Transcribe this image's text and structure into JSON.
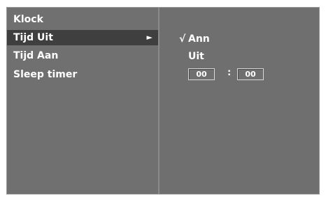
{
  "menu": {
    "items": [
      {
        "label": "Klock"
      },
      {
        "label": "Tijd Uit",
        "arrow": "►"
      },
      {
        "label": "Tijd Aan"
      },
      {
        "label": "Sleep timer"
      }
    ],
    "selected_index": 1
  },
  "submenu": {
    "check_mark": "√",
    "options": [
      {
        "label": "Ann",
        "checked": true
      },
      {
        "label": "Uit",
        "checked": false
      }
    ],
    "time": {
      "hours": "00",
      "separator": ":",
      "minutes": "00"
    }
  },
  "colors": {
    "panel": "#707070",
    "selected_row": "#3f3f3f",
    "text": "#ffffff"
  }
}
